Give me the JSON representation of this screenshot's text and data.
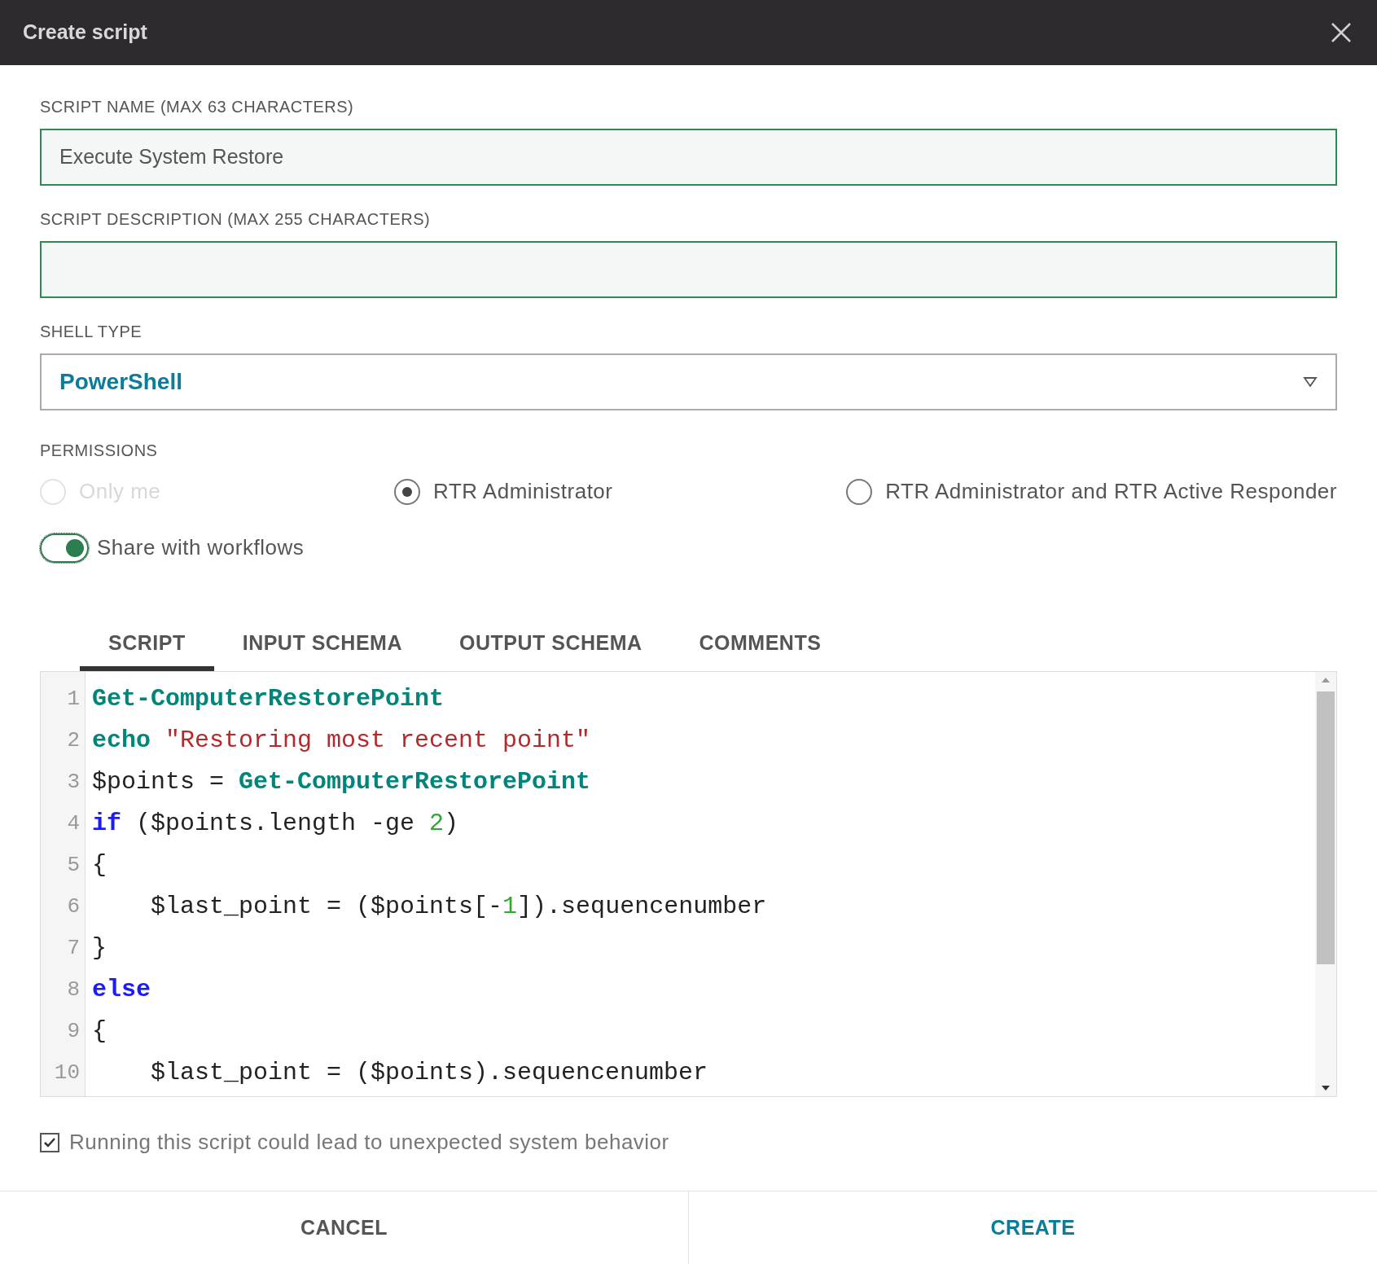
{
  "window": {
    "title": "Create script"
  },
  "fields": [
    {
      "label": "SCRIPT NAME (MAX 63 CHARACTERS)",
      "value": "Execute System Restore"
    },
    {
      "label": "SCRIPT DESCRIPTION (MAX 255 CHARACTERS)"
    }
  ],
  "shell_type": {
    "label": "SHELL TYPE",
    "value": "PowerShell"
  },
  "permissions": {
    "label": "PERMISSIONS",
    "options": [
      {
        "label": "Only me",
        "selected": false,
        "disabled": true
      },
      {
        "label": "RTR Administrator",
        "selected": true,
        "disabled": false
      },
      {
        "label": "RTR Administrator and RTR Active Responder",
        "selected": false,
        "disabled": false
      }
    ]
  },
  "share_toggle": {
    "label": "Share with workflows",
    "on": true
  },
  "tabs": [
    {
      "label": "SCRIPT",
      "selected": true
    },
    {
      "label": "INPUT SCHEMA",
      "selected": false
    },
    {
      "label": "OUTPUT SCHEMA",
      "selected": false
    },
    {
      "label": "COMMENTS",
      "selected": false
    }
  ],
  "editor": {
    "lines": [
      {
        "number": "1",
        "tokens": [
          {
            "kind": "cmdlet",
            "text": "Get-ComputerRestorePoint"
          }
        ]
      },
      {
        "number": "2",
        "tokens": [
          {
            "kind": "cmdlet",
            "text": "echo"
          },
          {
            "kind": "string",
            "text": "\"Restoring most recent point\""
          }
        ]
      },
      {
        "number": "3",
        "tokens": [
          {
            "kind": "plain",
            "text": "$points = "
          },
          {
            "kind": "cmdlet",
            "text": "Get-ComputerRestorePoint"
          }
        ]
      },
      {
        "number": "4",
        "tokens": [
          {
            "kind": "keyword",
            "text": "if"
          },
          {
            "kind": "plain",
            "text": " ($points.length -ge "
          },
          {
            "kind": "number",
            "text": "2"
          },
          {
            "kind": "plain",
            "text": ")"
          }
        ]
      },
      {
        "number": "5",
        "tokens": [
          {
            "kind": "plain",
            "text": "{"
          }
        ]
      },
      {
        "number": "6",
        "tokens": [
          {
            "kind": "plain",
            "text": "    $last_point = ($points[-"
          },
          {
            "kind": "number",
            "text": "1"
          },
          {
            "kind": "plain",
            "text": "]).sequencenumber"
          }
        ]
      },
      {
        "number": "7",
        "tokens": [
          {
            "kind": "plain",
            "text": "}"
          }
        ]
      },
      {
        "number": "8",
        "tokens": [
          {
            "kind": "keyword",
            "text": "else"
          }
        ]
      },
      {
        "number": "9",
        "tokens": [
          {
            "kind": "plain",
            "text": "{"
          }
        ]
      },
      {
        "number": "10",
        "tokens": [
          {
            "kind": "plain",
            "text": "    $last_point = ($points).sequencenumber"
          }
        ]
      }
    ]
  },
  "warning": {
    "label": "Running this script could lead to unexpected system behavior",
    "checked": true
  },
  "buttons": [
    {
      "label": "CANCEL",
      "kind": "secondary"
    },
    {
      "label": "CREATE",
      "kind": "primary"
    }
  ]
}
